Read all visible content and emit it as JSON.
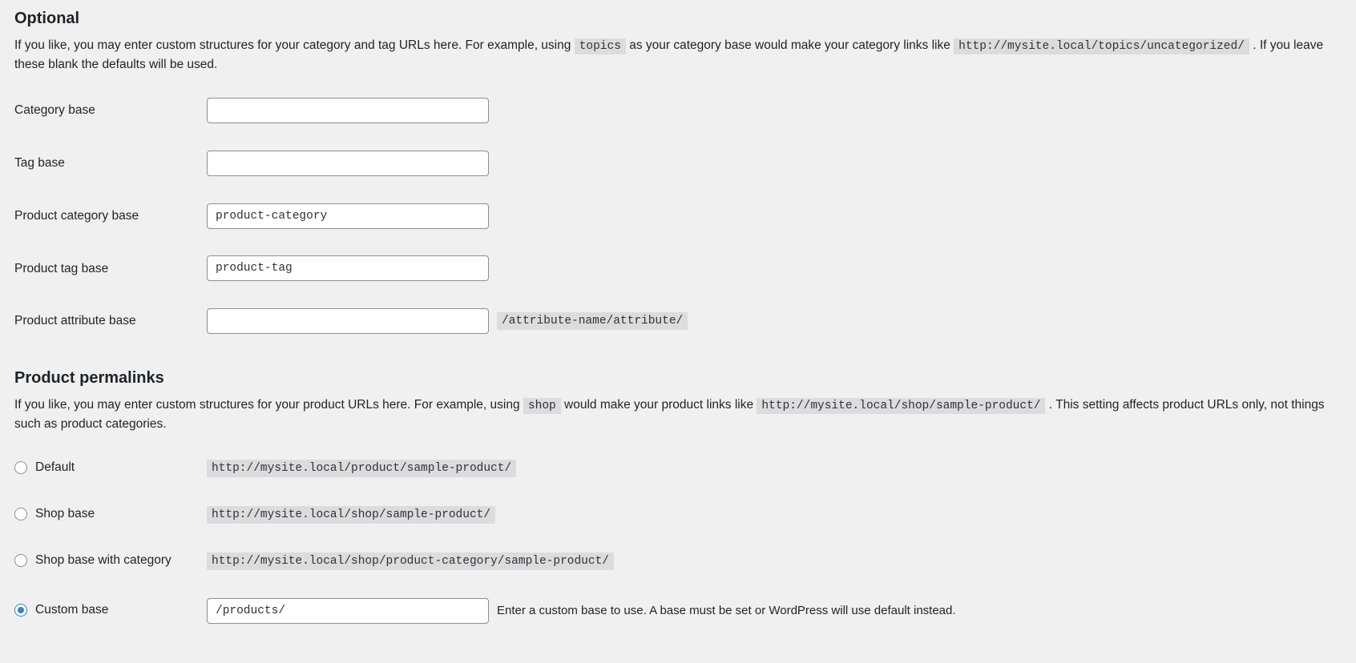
{
  "optional_section": {
    "heading": "Optional",
    "desc_part1": "If you like, you may enter custom structures for your category and tag URLs here. For example, using",
    "desc_code1": "topics",
    "desc_part2": "as your category base would make your category links like",
    "desc_code2": "http://mysite.local/topics/uncategorized/",
    "desc_part3": ". If you leave these blank the defaults will be used.",
    "fields": [
      {
        "label": "Category base",
        "value": "",
        "placeholder": "",
        "suffix": ""
      },
      {
        "label": "Tag base",
        "value": "",
        "placeholder": "",
        "suffix": ""
      },
      {
        "label": "Product category base",
        "value": "product-category",
        "placeholder": "",
        "suffix": ""
      },
      {
        "label": "Product tag base",
        "value": "product-tag",
        "placeholder": "",
        "suffix": ""
      },
      {
        "label": "Product attribute base",
        "value": "",
        "placeholder": "",
        "suffix": "/attribute-name/attribute/"
      }
    ]
  },
  "product_permalinks_section": {
    "heading": "Product permalinks",
    "desc_part1": "If you like, you may enter custom structures for your product URLs here. For example, using",
    "desc_code1": "shop",
    "desc_part2": "would make your product links like",
    "desc_code2": "http://mysite.local/shop/sample-product/",
    "desc_part3": ". This setting affects product URLs only, not things such as product categories.",
    "options": [
      {
        "label": "Default",
        "url": "http://mysite.local/product/sample-product/",
        "selected": false
      },
      {
        "label": "Shop base",
        "url": "http://mysite.local/shop/sample-product/",
        "selected": false
      },
      {
        "label": "Shop base with category",
        "url": "http://mysite.local/shop/product-category/sample-product/",
        "selected": false
      }
    ],
    "custom_option": {
      "label": "Custom base",
      "selected": true,
      "value": "/products/",
      "placeholder": "",
      "help": "Enter a custom base to use. A base must be set or WordPress will use default instead."
    }
  },
  "colors": {
    "accent": "#3582c4",
    "page_bg": "#f0f0f1",
    "code_bg": "#dcdcde",
    "border": "#8c8f94",
    "text": "#1d2327"
  }
}
